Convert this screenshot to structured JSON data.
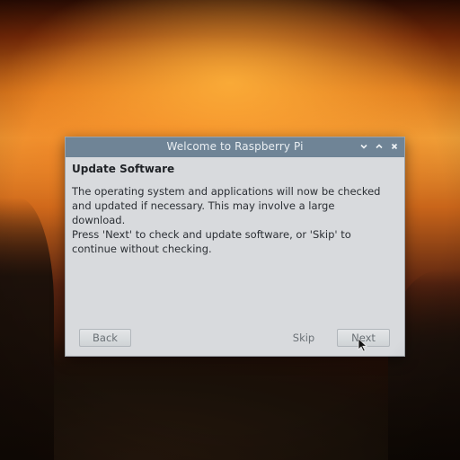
{
  "window": {
    "title": "Welcome to Raspberry Pi",
    "controls": [
      "chevron-down-icon",
      "chevron-up-icon",
      "close-icon"
    ]
  },
  "page": {
    "heading": "Update Software",
    "paragraph1": "The operating system and applications will now be checked and updated if necessary. This may involve a large download.",
    "paragraph2": "Press 'Next' to check and update software, or 'Skip' to continue without checking."
  },
  "buttons": {
    "back": "Back",
    "skip": "Skip",
    "next": "Next"
  },
  "colors": {
    "titlebar": "#6f8496",
    "dialog_bg": "#d8dadd"
  }
}
